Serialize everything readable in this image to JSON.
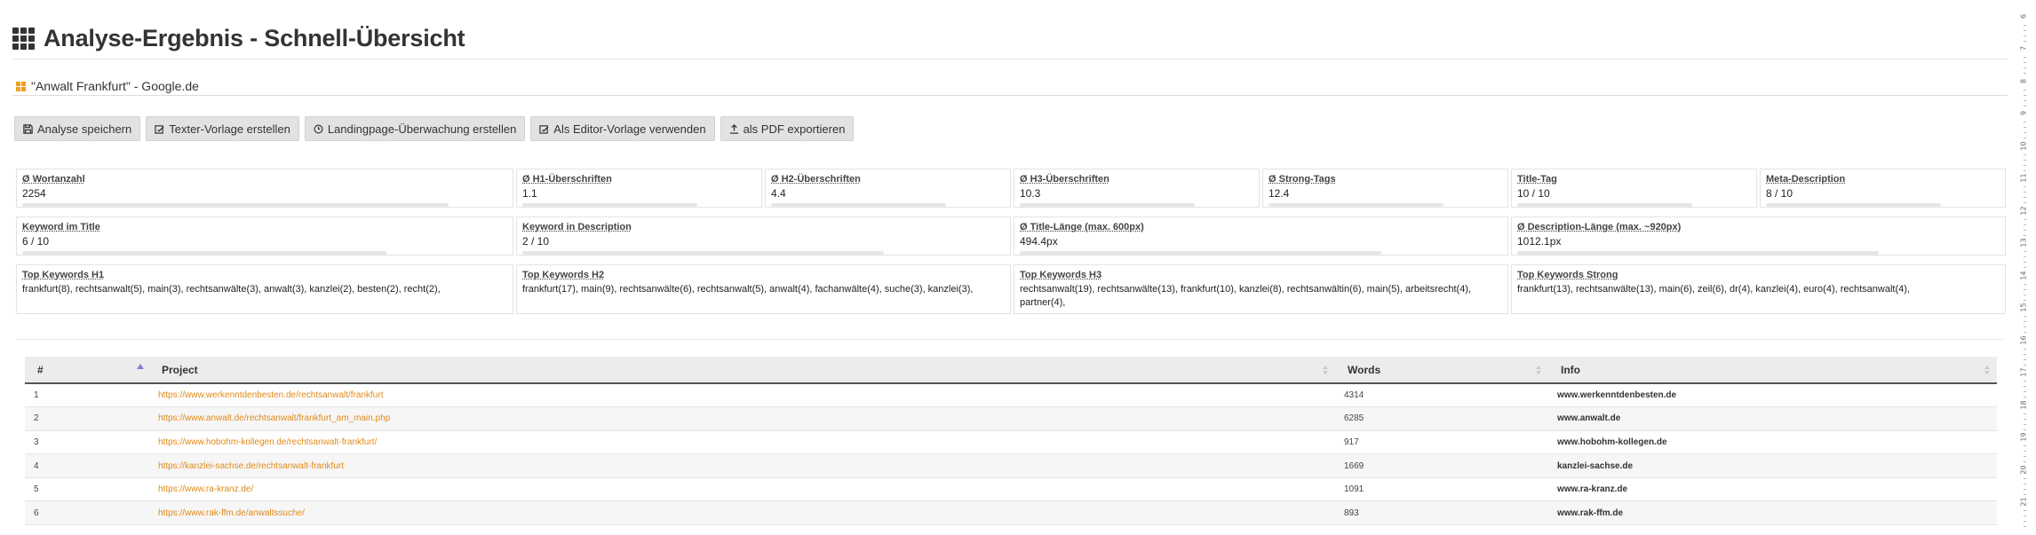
{
  "header": {
    "title": "Analyse-Ergebnis - Schnell-Übersicht",
    "subtitle": "\"Anwalt Frankfurt\" - Google.de"
  },
  "toolbar": {
    "buttons": [
      {
        "icon": "save-icon",
        "label": "Analyse speichern"
      },
      {
        "icon": "edit-icon",
        "label": "Texter-Vorlage erstellen"
      },
      {
        "icon": "clock-icon",
        "label": "Landingpage-Überwachung erstellen"
      },
      {
        "icon": "edit-icon",
        "label": "Als Editor-Vorlage verwenden"
      },
      {
        "icon": "export-icon",
        "label": "als PDF exportieren"
      }
    ]
  },
  "stats_row1": [
    {
      "label": "Ø Wortanzahl",
      "value": "2254"
    },
    {
      "label": "Ø H1-Überschriften",
      "value": "1.1"
    },
    {
      "label": "Ø H2-Überschriften",
      "value": "4.4"
    },
    {
      "label": "Ø H3-Überschriften",
      "value": "10.3"
    },
    {
      "label": "Ø Strong-Tags",
      "value": "12.4"
    },
    {
      "label": "Title-Tag",
      "value": "10 / 10"
    },
    {
      "label": "Meta-Description",
      "value": "8 / 10"
    }
  ],
  "stats_row2": [
    {
      "label": "Keyword im Title",
      "value": "6 / 10"
    },
    {
      "label": "Keyword in Description",
      "value": "2 / 10"
    },
    {
      "label": "Ø Title-Länge (max. 600px)",
      "value": "494.4px"
    },
    {
      "label": "Ø Description-Länge (max. ~920px)",
      "value": "1012.1px"
    }
  ],
  "stats_row3": [
    {
      "label": "Top Keywords H1",
      "value": "frankfurt(8), rechtsanwalt(5), main(3), rechtsanwälte(3), anwalt(3), kanzlei(2), besten(2), recht(2),"
    },
    {
      "label": "Top Keywords H2",
      "value": "frankfurt(17), main(9), rechtsanwälte(6), rechtsanwalt(5), anwalt(4), fachanwälte(4), suche(3), kanzlei(3),"
    },
    {
      "label": "Top Keywords H3",
      "value": "rechtsanwalt(19), rechtsanwälte(13), frankfurt(10), kanzlei(8), rechtsanwältin(6), main(5), arbeitsrecht(4), partner(4),"
    },
    {
      "label": "Top Keywords Strong",
      "value": "frankfurt(13), rechtsanwälte(13), main(6), zeil(6), dr(4), kanzlei(4), euro(4), rechtsanwalt(4),"
    }
  ],
  "table": {
    "headers": [
      "#",
      "Project",
      "Words",
      "Info"
    ],
    "rows": [
      {
        "num": "1",
        "url": "https://www.werkenntdenbesten.de/rechtsanwalt/frankfurt",
        "words": "4314",
        "info": "www.werkenntdenbesten.de"
      },
      {
        "num": "2",
        "url": "https://www.anwalt.de/rechtsanwalt/frankfurt_am_main.php",
        "words": "6285",
        "info": "www.anwalt.de"
      },
      {
        "num": "3",
        "url": "https://www.hobohm-kollegen.de/rechtsanwalt-frankfurt/",
        "words": "917",
        "info": "www.hobohm-kollegen.de"
      },
      {
        "num": "4",
        "url": "https://kanzlei-sachse.de/rechtsanwalt-frankfurt",
        "words": "1669",
        "info": "kanzlei-sachse.de"
      },
      {
        "num": "5",
        "url": "https://www.ra-kranz.de/",
        "words": "1091",
        "info": "www.ra-kranz.de"
      },
      {
        "num": "6",
        "url": "https://www.rak-ffm.de/anwaltssuche/",
        "words": "893",
        "info": "www.rak-ffm.de"
      }
    ]
  },
  "ruler": {
    "ticks": [
      "6",
      "7",
      "8",
      "9",
      "10",
      "11",
      "12",
      "13",
      "14",
      "15",
      "16",
      "17",
      "18",
      "19",
      "20",
      "21"
    ]
  }
}
